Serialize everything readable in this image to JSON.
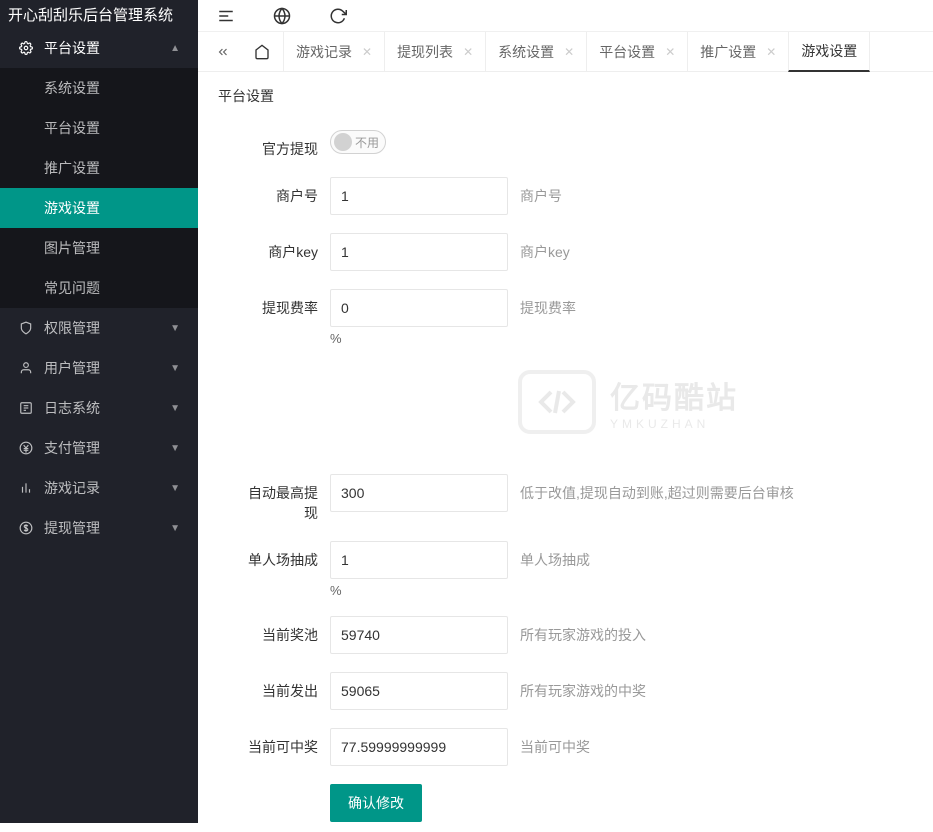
{
  "app": {
    "title": "开心刮刮乐后台管理系统"
  },
  "sidebar": {
    "items": [
      {
        "label": "平台设置",
        "expanded": true,
        "sub": [
          {
            "label": "系统设置"
          },
          {
            "label": "平台设置"
          },
          {
            "label": "推广设置"
          },
          {
            "label": "游戏设置",
            "active": true
          },
          {
            "label": "图片管理"
          },
          {
            "label": "常见问题"
          }
        ]
      },
      {
        "label": "权限管理"
      },
      {
        "label": "用户管理"
      },
      {
        "label": "日志系统"
      },
      {
        "label": "支付管理"
      },
      {
        "label": "游戏记录"
      },
      {
        "label": "提现管理"
      }
    ]
  },
  "tabs": {
    "items": [
      {
        "label": "游戏记录"
      },
      {
        "label": "提现列表"
      },
      {
        "label": "系统设置"
      },
      {
        "label": "平台设置"
      },
      {
        "label": "推广设置"
      },
      {
        "label": "游戏设置",
        "active": true
      }
    ]
  },
  "page": {
    "title": "平台设置"
  },
  "form": {
    "official_withdraw": {
      "label": "官方提现",
      "switch_text": "不用"
    },
    "merchant_id": {
      "label": "商户号",
      "value": "1",
      "hint": "商户号"
    },
    "merchant_key": {
      "label": "商户key",
      "value": "1",
      "hint": "商户key"
    },
    "withdraw_rate": {
      "label": "提现费率",
      "value": "0",
      "hint": "提现费率",
      "suffix": "%"
    },
    "auto_max_withdraw": {
      "label": "自动最高提现",
      "value": "300",
      "hint": "低于改值,提现自动到账,超过则需要后台审核"
    },
    "single_rake": {
      "label": "单人场抽成",
      "value": "1",
      "hint": "单人场抽成",
      "suffix": "%"
    },
    "current_pool": {
      "label": "当前奖池",
      "value": "59740",
      "hint": "所有玩家游戏的投入"
    },
    "current_out": {
      "label": "当前发出",
      "value": "59065",
      "hint": "所有玩家游戏的中奖"
    },
    "current_winable": {
      "label": "当前可中奖",
      "value": "77.59999999999",
      "hint": "当前可中奖"
    },
    "submit": "确认修改"
  },
  "watermark": {
    "ch": "亿码酷站",
    "en": "YMKUZHAN"
  }
}
